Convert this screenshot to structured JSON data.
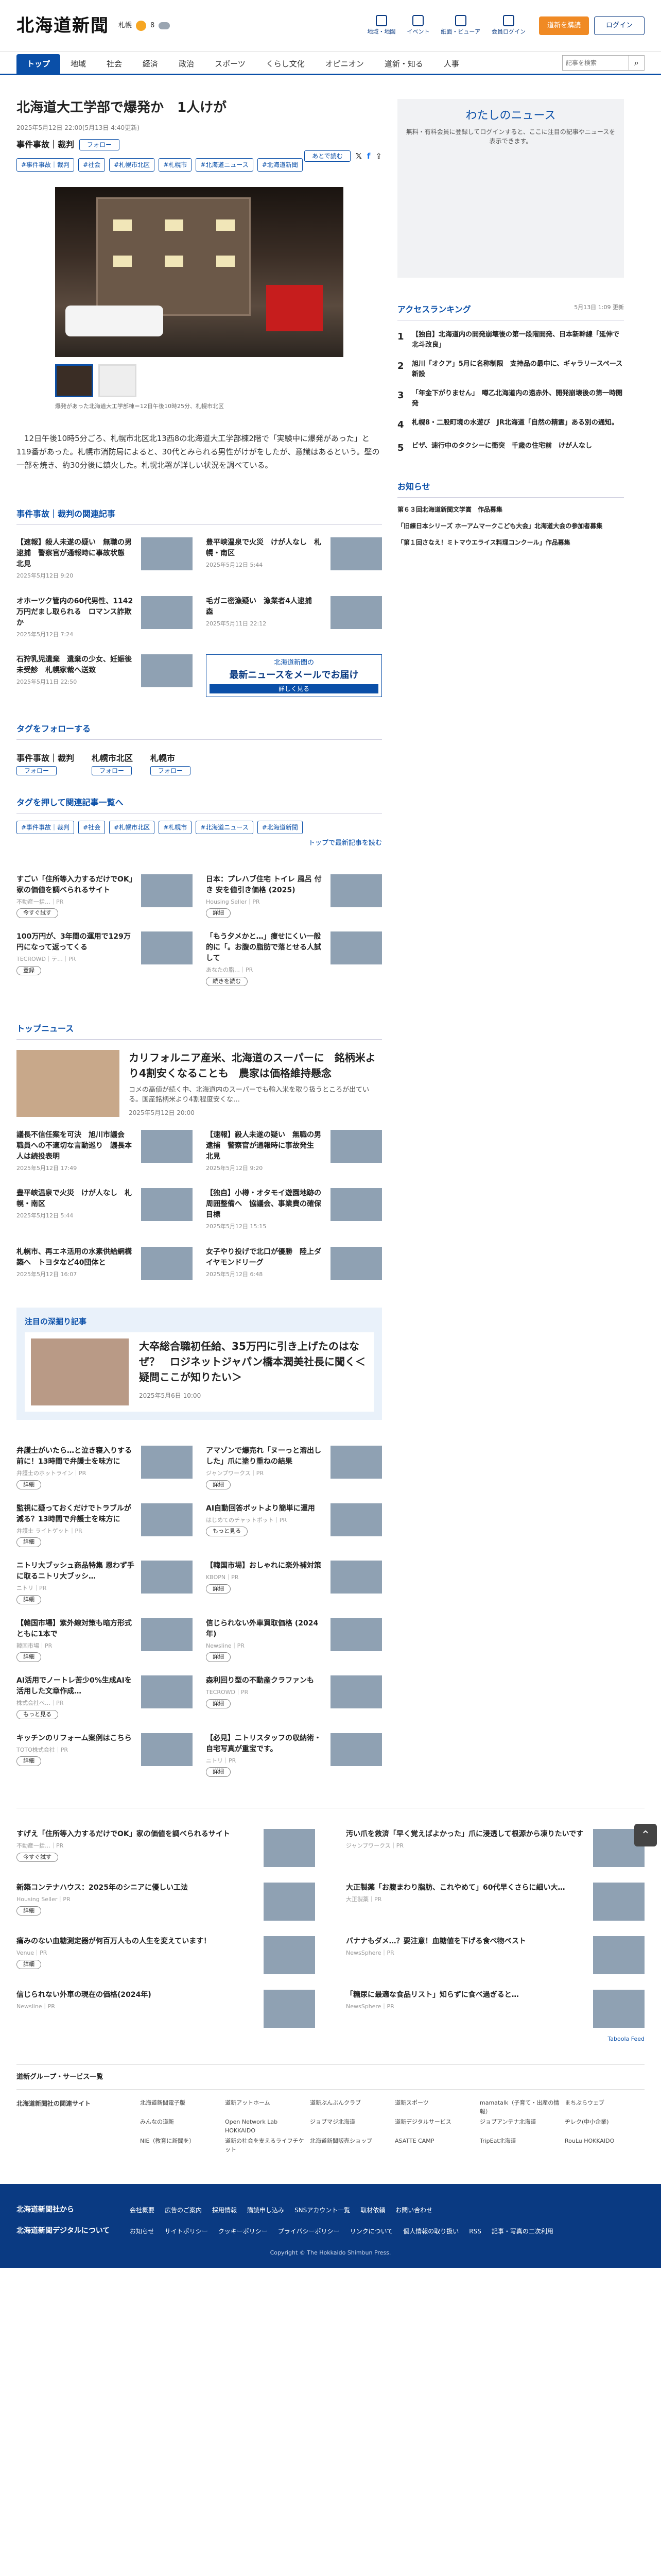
{
  "header": {
    "logo": "北海道新聞",
    "weather": "札幌",
    "temp": "8",
    "hicons": [
      "地域・地図",
      "イベント",
      "紙面・ビューア",
      "会員ログイン"
    ],
    "subscribe": "道新を購読",
    "login": "ログイン"
  },
  "nav": {
    "items": [
      "トップ",
      "地域",
      "社会",
      "経済",
      "政治",
      "スポーツ",
      "くらし文化",
      "オピニオン",
      "道新・知る",
      "人事"
    ],
    "search_placeholder": "記事を検索"
  },
  "article": {
    "title": "北海道大工学部で爆発か　1人けが",
    "date": "2025年5月12日 22:00(5月13日 4:40更新)",
    "category": "事件事故｜裁判",
    "follow": "フォロー",
    "save": "あとで読む",
    "tags": [
      "#事件事故｜裁判",
      "#社会",
      "#札幌市北区",
      "#札幌市",
      "#北海道ニュース",
      "#北海道新聞"
    ],
    "caption": "爆発があった北海道大工学部棟＝12日午後10時25分、札幌市北区",
    "body": "　12日午後10時5分ごろ、札幌市北区北13西8の北海道大工学部棟2階で「実験中に爆発があった」と119番があった。札幌市消防局によると、30代とみられる男性がけがをしたが、意識はあるという。壁の一部を焼き、約30分後に鎮火した。札幌北署が詳しい状況を調べている。"
  },
  "related": {
    "heading": "事件事故｜裁判の関連記事",
    "items": [
      {
        "t": "【速報】殺人未遂の疑い　無職の男逮捕　警察官が通報時に事故状態　北見",
        "d": "2025年5月12日 9:20"
      },
      {
        "t": "豊平峡温泉で火災　けが人なし　札幌・南区",
        "d": "2025年5月12日 5:44"
      },
      {
        "t": "オホーツク管内の60代男性、1142万円だまし取られる　ロマンス詐欺か",
        "d": "2025年5月12日 7:24"
      },
      {
        "t": "毛ガニ密漁疑い　漁業者4人逮捕　森",
        "d": "2025年5月11日 22:12"
      },
      {
        "t": "石狩乳児遺棄　遺棄の少女、妊娠後未受診　札幌家裁へ送致",
        "d": "2025年5月11日 22:50"
      }
    ],
    "nl_a": "北海道新聞の",
    "nl_b": "最新ニュースをメールでお届け",
    "nl_c": "詳しく見る"
  },
  "followtags": {
    "heading": "タグをフォローする",
    "items": [
      "事件事故｜裁判",
      "札幌市北区",
      "札幌市"
    ],
    "follow": "フォロー"
  },
  "tagsearch": {
    "heading": "タグを押して関連記事一覧へ",
    "more": "トップで最新記事を読む"
  },
  "ads1": [
    {
      "t": "すごい「住所等入力するだけでOK」家の価値を調べられるサイト",
      "s": "不動産一括…｜PR",
      "b": "今すぐ試す"
    },
    {
      "t": "日本：プレハブ住宅 トイレ 風呂 付き 安を値引き価格 (2025)",
      "s": "Housing Seller｜PR",
      "b": "詳細"
    },
    {
      "t": "100万円が、3年間の運用で129万円になって返ってくる",
      "s": "TECROWD｜テ…｜PR",
      "b": "登録"
    },
    {
      "t": "「もう夕メかと…」痩せにくい一般的に「。お腹の脂肪で落とせる人試して",
      "s": "あなたの脂…｜PR",
      "b": "続きを読む"
    }
  ],
  "top": {
    "heading": "トップニュース",
    "lead": {
      "t": "カリフォルニア産米、北海道のスーパーに　銘柄米より4割安くなることも　農家は価格維持懸念",
      "x": "コメの高値が続く中、北海道内のスーパーでも輸入米を取り扱うところが出ている。国産銘柄米より4割程度安くな…",
      "d": "2025年5月12日 20:00"
    },
    "items": [
      {
        "t": "議長不信任案を可決　旭川市議会　職員への不適切な言動巡り　議長本人は続投表明",
        "d": "2025年5月12日 17:49"
      },
      {
        "t": "【速報】殺人未遂の疑い　無職の男逮捕　警察官が通報時に事故発生　北見",
        "d": "2025年5月12日 9:20"
      },
      {
        "t": "豊平峡温泉で火災　けが人なし　札幌・南区",
        "d": "2025年5月12日 5:44"
      },
      {
        "t": "【独自】小樽・オタモイ遊園地跡の周囲整備へ　協議会、事業費の確保目標",
        "d": "2025年5月12日 15:15"
      },
      {
        "t": "札幌市、再エネ活用の水素供給網構築へ　トヨタなど40団体と",
        "d": "2025年5月12日 16:07"
      },
      {
        "t": "女子やり投げで北口が優勝　陸上ダイヤモンドリーグ",
        "d": "2025年5月12日 6:48"
      }
    ]
  },
  "feature": {
    "heading": "注目の深掘り記事",
    "t": "大卒総合職初任給、35万円に引き上げたのはなぜ？　ロジネットジャパン橋本潤美社長に聞く＜疑問ここが知りたい＞",
    "d": "2025年5月6日 10:00"
  },
  "ads2": [
    {
      "t": "弁護士がいたら…と泣き寝入りする前に！13時間で弁護士を味方に",
      "s": "弁護士のホットライン｜PR",
      "b": "詳細"
    },
    {
      "t": "アマゾンで爆売れ「ヌーっと溶出しした」爪に塗り重ねの結果",
      "s": "ジャンプワークス｜PR",
      "b": "詳細"
    },
    {
      "t": "監視に疑っておくだけでトラブルが減る？13時間で弁護士を味方に",
      "s": "弁護士 ライトゲット｜PR",
      "b": "詳細"
    },
    {
      "t": "AI自動回答ボットより簡単に運用",
      "s": "はじめてのチャットボット｜PR",
      "b": "もっと見る"
    },
    {
      "t": "ニトリ大ブッシュ商品特集 恩わず手に取るニトリ大ブッシ…",
      "s": "ニトリ｜PR",
      "b": "詳細"
    },
    {
      "t": "【韓国市場】おしゃれに楽外補対策",
      "s": "KBOPN｜PR",
      "b": "詳細"
    },
    {
      "t": "【韓国市場】紫外線対策も暗方形式ともに1本で",
      "s": "韓国市場｜PR",
      "b": "詳細"
    },
    {
      "t": "信じられない外車買取価格 (2024年)",
      "s": "Newsline｜PR",
      "b": "詳細"
    },
    {
      "t": "AI活用でノートレ苦少0%生成AIを活用した文章作成…",
      "s": "株式会社ベ…｜PR",
      "b": "もっと見る"
    },
    {
      "t": "森利回り型の不動産クラファンも",
      "s": "TECROWD｜PR",
      "b": "詳細"
    },
    {
      "t": "キッチンのリフォーム案例はこちら",
      "s": "TOTO株式会社｜PR",
      "b": "詳細"
    },
    {
      "t": "【必見】ニトリスタッフの収納術・自宅写真が重宝です。",
      "s": "ニトリ｜PR",
      "b": "詳細"
    }
  ],
  "side": {
    "box_title": "わたしのニュース",
    "box_text": "無料・有料会員に登録してログインすると、ここに注目の記事やニュースを表示できます。",
    "rank_heading": "アクセスランキング",
    "rank_date": "5月13日 1:09 更新",
    "ranks": [
      "【独自】北海道内の開発崩壊後の第一段階開発、日本新幹線「延伸で北斗改良」",
      "旭川「オクア」5月に名称制限　支持品の最中に、ギャラリースペース新設",
      "「年金下がりません」　噂乙北海道内の遠赤外、開発崩壊後の第一時開発",
      "札幌8・二股町境の水遊び　JR北海道「自然の精霊」ある別の通知。",
      "ビザ、速行中のタクシーに衝突　千歳の住宅前　けが人なし"
    ],
    "notice_heading": "お知らせ",
    "notices": [
      "第６３回北海道新聞文学賞　作品募集",
      "「旧練日本シリーズ ホーアムマークこども大会」北海道大会の参加者募集",
      "「第１回さなえ！ミトマウエライス料理コンクール」作品募集"
    ]
  },
  "ads3": [
    {
      "t": "すげえ「住所等入力するだけでOK」家の価値を調べられるサイト",
      "s": "不動産一括…｜PR",
      "b": "今すぐ試す"
    },
    {
      "t": "汚い爪を救済「早く覚えばよかった」爪に浸透して根源から凍りたいです",
      "s": "ジャンプワークス｜PR",
      "b": ""
    },
    {
      "t": "新築コンテナハウス：2025年のシニアに優しい工法",
      "s": "Housing Seller｜PR",
      "b": "詳細"
    },
    {
      "t": "大正製薬「お腹まわり脂肪、これやめて」60代早くさらに細い大…",
      "s": "大正製薬｜PR",
      "b": ""
    },
    {
      "t": "痛みのない血糖測定器が何百万人もの人生を変えています！",
      "s": "Venue｜PR",
      "b": "詳細"
    },
    {
      "t": "バナナもダメ…？要注意！血糖値を下げる食べ物ベスト",
      "s": "NewsSphere｜PR",
      "b": ""
    },
    {
      "t": "信じられない外車の現在の価格(2024年)",
      "s": "Newsline｜PR",
      "b": ""
    },
    {
      "t": "「糖尿に最適な食品リスト」知らずに食べ過ぎると…",
      "s": "NewsSphere｜PR",
      "b": ""
    }
  ],
  "footer": {
    "group_heading": "道新グループ・サービス一覧",
    "site_heading": "北海道新聞社の関連サイト",
    "links": [
      "北海道新聞電子版",
      "道新アットホーム",
      "道新ぶんぶんクラブ",
      "道新スポーツ",
      "mamatalk（子育て・出産の情報）",
      "まちぶらウェブ",
      "みんなの道新",
      "Open Network Lab HOKKAIDO",
      "ジョブマジ北海道",
      "道新デジタルサービス",
      "ジョブアンテナ北海道",
      "ヂレク(中小企業)",
      "NIE（教育に新聞を）",
      "道新の社会を支えるライフチケット",
      "北海道新聞販売ショップ",
      "ASATTE CAMP",
      "TripEat北海道",
      "RouLu HOKKAIDO"
    ],
    "f1": "北海道新聞社から",
    "f1links": [
      "会社概要",
      "広告のご案内",
      "採用情報",
      "購読申し込み",
      "SNSアカウント一覧",
      "取材依頼",
      "お問い合わせ"
    ],
    "f2": "北海道新聞デジタルについて",
    "f2links": [
      "お知らせ",
      "サイトポリシー",
      "クッキーポリシー",
      "プライバシーポリシー",
      "リンクについて",
      "個人情報の取り扱い",
      "RSS",
      "記事・写真の二次利用"
    ],
    "copy": "Copyright © The Hokkaido Shimbun Press."
  }
}
